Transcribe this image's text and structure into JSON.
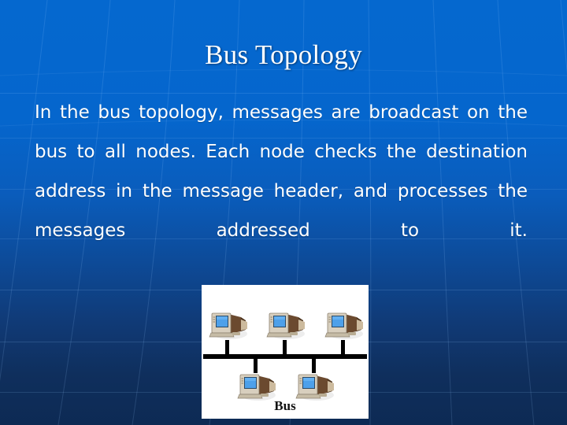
{
  "slide": {
    "title": "Bus Topology",
    "body": "In the bus topology, messages are broadcast on the bus to all nodes. Each node checks the destination address in the message header, and processes the messages addressed to it.",
    "background": {
      "top_color": "#0568cf",
      "bottom_color": "#0d2a54",
      "mesh_color": "#96c8ff",
      "style": "globe-mesh-gradient"
    },
    "title_color": "#ffffff",
    "body_color": "#ffffff"
  },
  "figure": {
    "caption": "Bus",
    "caption_color": "#121212",
    "background": "#ffffff",
    "bus_line_color": "#000000",
    "node_count": 5,
    "nodes_above": 3,
    "nodes_below": 2,
    "node_icon": "computer-monitor-icon",
    "screen_color": "#4da0ea",
    "case_color": "#d8cfbe",
    "body_color": "#6b4a2f",
    "alt": "Bus topology diagram: five computers attached by drop cables to a single horizontal bus line"
  }
}
